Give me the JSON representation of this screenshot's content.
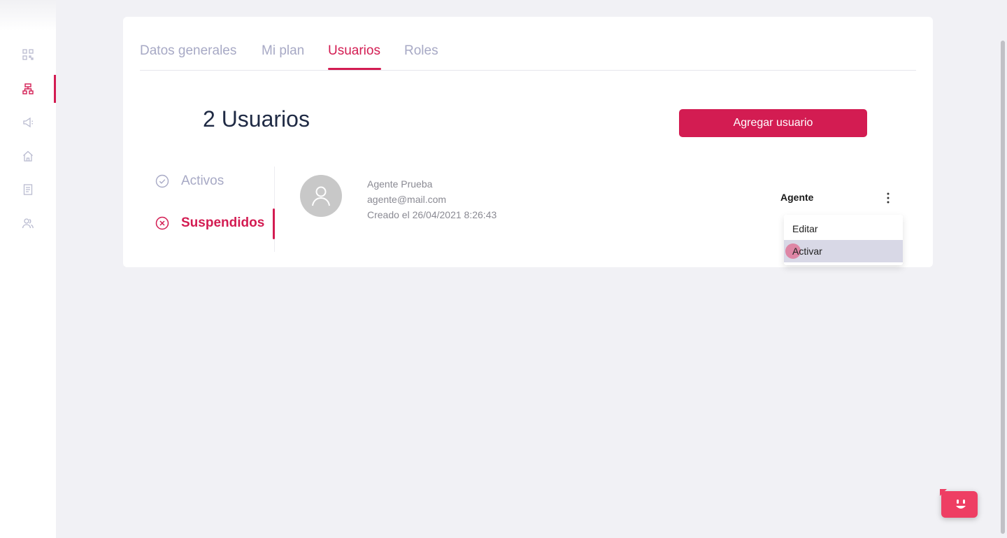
{
  "sidebar": {
    "items": [
      {
        "icon": "qr-code-icon",
        "active": false
      },
      {
        "icon": "organization-icon",
        "active": true
      },
      {
        "icon": "megaphone-icon",
        "active": false
      },
      {
        "icon": "home-icon",
        "active": false
      },
      {
        "icon": "receipt-icon",
        "active": false
      },
      {
        "icon": "users-icon",
        "active": false
      }
    ]
  },
  "tabs": [
    {
      "label": "Datos generales",
      "active": false
    },
    {
      "label": "Mi plan",
      "active": false
    },
    {
      "label": "Usuarios",
      "active": true
    },
    {
      "label": "Roles",
      "active": false
    }
  ],
  "main": {
    "count_title": "2 Usuarios",
    "add_button_label": "Agregar usuario"
  },
  "filters": [
    {
      "label": "Activos",
      "icon": "check-circle-icon",
      "active": false
    },
    {
      "label": "Suspendidos",
      "icon": "x-circle-icon",
      "active": true
    }
  ],
  "user": {
    "name": "Agente Prueba",
    "email": "agente@mail.com",
    "created": "Creado el 26/04/2021 8:26:43",
    "role": "Agente"
  },
  "context_menu": {
    "items": [
      {
        "label": "Editar"
      },
      {
        "label": "Activar",
        "hovered": true
      }
    ]
  },
  "colors": {
    "accent": "#d31c52",
    "muted_text": "#a7a9c5",
    "background": "#f1f1f5",
    "chat_widget": "#ee3e63"
  }
}
